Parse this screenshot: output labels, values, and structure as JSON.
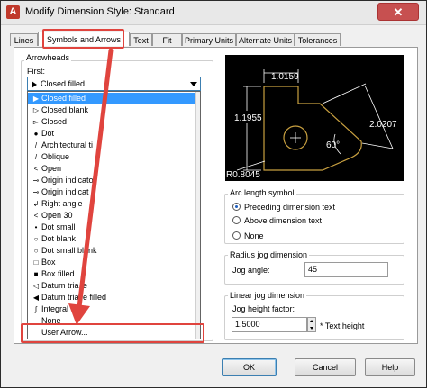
{
  "window": {
    "title": "Modify Dimension Style: Standard",
    "close_label": "✕"
  },
  "tabs": [
    {
      "label": "Lines"
    },
    {
      "label": "Symbols and Arrows"
    },
    {
      "label": "Text"
    },
    {
      "label": "Fit"
    },
    {
      "label": "Primary Units"
    },
    {
      "label": "Alternate Units"
    },
    {
      "label": "Tolerances"
    }
  ],
  "arrowheads": {
    "group_label": "Arrowheads",
    "first_label": "First:",
    "selected": "Closed filled",
    "items": [
      {
        "icon": "▶",
        "label": "Closed filled"
      },
      {
        "icon": "▷",
        "label": "Closed blank"
      },
      {
        "icon": "▻",
        "label": "Closed"
      },
      {
        "icon": "●",
        "label": "Dot"
      },
      {
        "icon": "/",
        "label": "Architectural ti"
      },
      {
        "icon": "/",
        "label": "Oblique"
      },
      {
        "icon": "<",
        "label": "Open"
      },
      {
        "icon": "⊸",
        "label": "Origin indicato"
      },
      {
        "icon": "⊸",
        "label": "Origin indicat   2"
      },
      {
        "icon": "↲",
        "label": "Right angle"
      },
      {
        "icon": "<",
        "label": "Open 30"
      },
      {
        "icon": "•",
        "label": "Dot small"
      },
      {
        "icon": "○",
        "label": "Dot blank"
      },
      {
        "icon": "○",
        "label": "Dot small blank"
      },
      {
        "icon": "□",
        "label": "Box"
      },
      {
        "icon": "■",
        "label": "Box filled"
      },
      {
        "icon": "◁",
        "label": "Datum tria   le"
      },
      {
        "icon": "◀",
        "label": "Datum tria   le filled"
      },
      {
        "icon": "∫",
        "label": "Integral"
      },
      {
        "icon": "",
        "label": "None"
      },
      {
        "icon": "",
        "label": "User Arrow..."
      }
    ]
  },
  "preview": {
    "dim_top": "1.0159",
    "dim_left": "1.1955",
    "dim_right": "2.0207",
    "dim_angle": "60°",
    "dim_radius": "R0.8045"
  },
  "arc_length": {
    "group_label": "Arc length symbol",
    "options": [
      "Preceding dimension text",
      "Above dimension text",
      "None"
    ],
    "selected_index": 0
  },
  "radius_jog": {
    "group_label": "Radius jog dimension",
    "jog_angle_label": "Jog angle:",
    "jog_angle_value": "45"
  },
  "linear_jog": {
    "group_label": "Linear jog dimension",
    "height_factor_label": "Jog height factor:",
    "height_factor_value": "1.5000",
    "suffix": "* Text height"
  },
  "buttons": {
    "ok": "OK",
    "cancel": "Cancel",
    "help": "Help"
  },
  "colors": {
    "annotation": "#e0443e",
    "selection": "#3399ff",
    "preview_lines": "#c8a040"
  }
}
